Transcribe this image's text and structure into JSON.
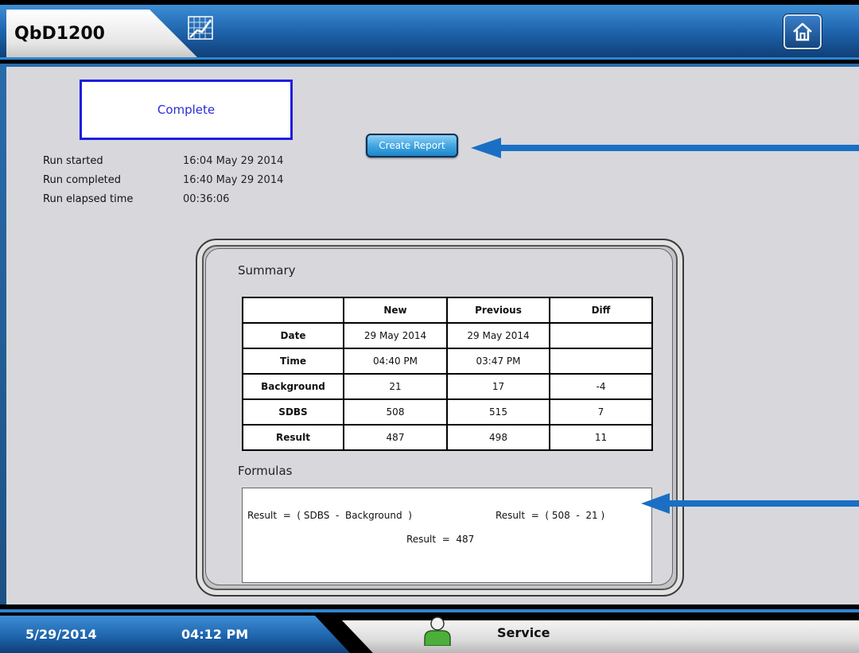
{
  "header": {
    "app_title": "QbD1200",
    "chart_icon": "chart-icon",
    "home_icon": "home-icon"
  },
  "status": {
    "label": "Complete"
  },
  "run_info": [
    {
      "label": "Run started",
      "value": "16:04 May 29 2014"
    },
    {
      "label": "Run completed",
      "value": "16:40 May 29 2014"
    },
    {
      "label": "Run elapsed time",
      "value": "00:36:06"
    }
  ],
  "actions": {
    "create_report": "Create Report"
  },
  "summary": {
    "title": "Summary",
    "columns": [
      "",
      "New",
      "Previous",
      "Diff"
    ],
    "rows": [
      [
        "Date",
        "29 May 2014",
        "29 May 2014",
        ""
      ],
      [
        "Time",
        "04:40 PM",
        "03:47 PM",
        ""
      ],
      [
        "Background",
        "21",
        "17",
        "-4"
      ],
      [
        "SDBS",
        "508",
        "515",
        "7"
      ],
      [
        "Result",
        "487",
        "498",
        "11"
      ]
    ]
  },
  "formulas": {
    "title": "Formulas",
    "line1_left": "Result  =  ( SDBS  -  Background  )",
    "line1_right": "Result  =  ( 508  -  21 )",
    "line2": "Result  =  487"
  },
  "footer": {
    "date": "5/29/2014",
    "time": "04:12 PM",
    "mode": "Service",
    "user_icon": "user-icon"
  },
  "colors": {
    "accent_blue": "#1f65ad",
    "status_border": "#1e1ee0",
    "arrow": "#1a6fc4"
  }
}
